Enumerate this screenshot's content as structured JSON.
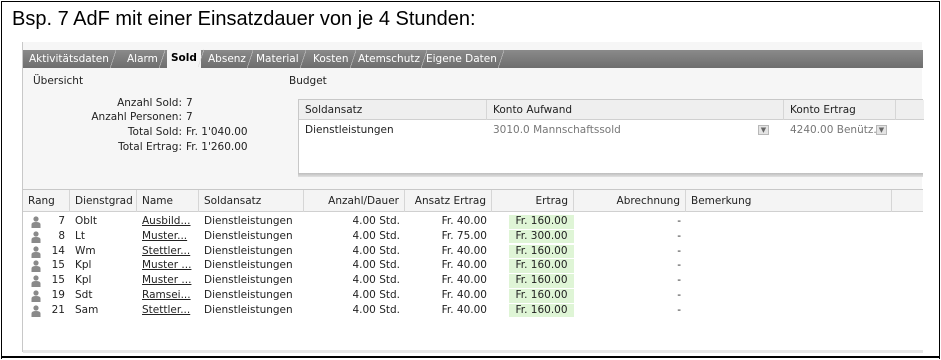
{
  "caption": "Bsp. 7 AdF mit einer Einsatzdauer von je 4 Stunden:",
  "tabs": [
    "Aktivitätsdaten",
    "Alarm",
    "Sold",
    "Absenz",
    "Material",
    "Kosten",
    "Atemschutz",
    "Eigene Daten"
  ],
  "active_tab": "Sold",
  "overview": {
    "title": "Übersicht",
    "rows": [
      {
        "label": "Anzahl Sold:",
        "value": "7"
      },
      {
        "label": "Anzahl Personen:",
        "value": "7"
      },
      {
        "label": "Total Sold:",
        "value": "Fr. 1'040.00"
      },
      {
        "label": "Total Ertrag:",
        "value": "Fr. 1'260.00"
      }
    ]
  },
  "budget": {
    "title": "Budget",
    "headers": [
      "Soldansatz",
      "Konto Aufwand",
      "Konto Ertrag"
    ],
    "row": {
      "soldansatz": "Dienstleistungen",
      "konto_aufwand": "3010.0 Mannschaftssold",
      "konto_ertrag": "4240.00 Benütz..."
    }
  },
  "grid": {
    "headers": [
      "Rang",
      "Dienstgrad",
      "Name",
      "Soldansatz",
      "Anzahl/Dauer",
      "Ansatz Ertrag",
      "Ertrag",
      "Abrechnung",
      "Bemerkung"
    ],
    "rows": [
      {
        "rang": "7",
        "dienstgrad": "Oblt",
        "name": "Ausbild...",
        "soldansatz": "Dienstleistungen",
        "dauer": "4.00 Std.",
        "ansatz": "Fr. 40.00",
        "ertrag": "Fr. 160.00",
        "abrechnung": "-"
      },
      {
        "rang": "8",
        "dienstgrad": "Lt",
        "name": "Muster...",
        "soldansatz": "Dienstleistungen",
        "dauer": "4.00 Std.",
        "ansatz": "Fr. 75.00",
        "ertrag": "Fr. 300.00",
        "abrechnung": "-"
      },
      {
        "rang": "14",
        "dienstgrad": "Wm",
        "name": "Stettler...",
        "soldansatz": "Dienstleistungen",
        "dauer": "4.00 Std.",
        "ansatz": "Fr. 40.00",
        "ertrag": "Fr. 160.00",
        "abrechnung": "-"
      },
      {
        "rang": "15",
        "dienstgrad": "Kpl",
        "name": "Muster ...",
        "soldansatz": "Dienstleistungen",
        "dauer": "4.00 Std.",
        "ansatz": "Fr. 40.00",
        "ertrag": "Fr. 160.00",
        "abrechnung": "-"
      },
      {
        "rang": "15",
        "dienstgrad": "Kpl",
        "name": "Muster ...",
        "soldansatz": "Dienstleistungen",
        "dauer": "4.00 Std.",
        "ansatz": "Fr. 40.00",
        "ertrag": "Fr. 160.00",
        "abrechnung": "-"
      },
      {
        "rang": "19",
        "dienstgrad": "Sdt",
        "name": "Ramsei...",
        "soldansatz": "Dienstleistungen",
        "dauer": "4.00 Std.",
        "ansatz": "Fr. 40.00",
        "ertrag": "Fr. 160.00",
        "abrechnung": "-"
      },
      {
        "rang": "21",
        "dienstgrad": "Sam",
        "name": "Stettler...",
        "soldansatz": "Dienstleistungen",
        "dauer": "4.00 Std.",
        "ansatz": "Fr. 40.00",
        "ertrag": "Fr. 160.00",
        "abrechnung": "-"
      }
    ]
  },
  "icons": {
    "person": "person-icon",
    "dropdown": "chevron-down-icon"
  },
  "colors": {
    "ertrag_bg": "#dff5d6",
    "tabbar": "#7a7a7a"
  }
}
